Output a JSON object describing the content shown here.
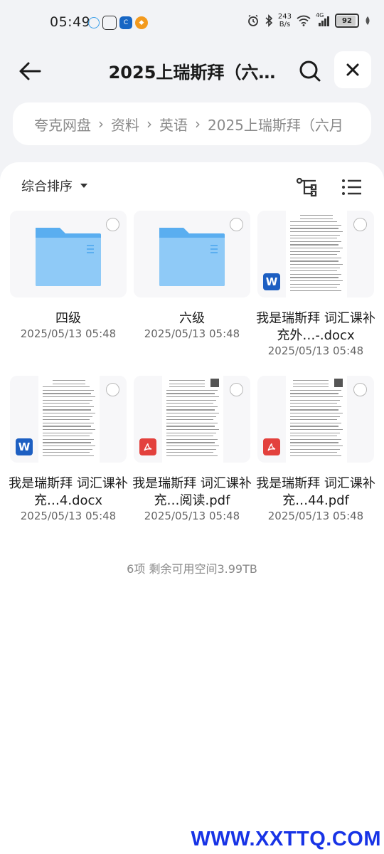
{
  "status_bar": {
    "time": "05:49",
    "net_speed_value": "243",
    "net_speed_unit": "B/s",
    "signal_label": "4G",
    "battery": "92",
    "battery_level": 0.92,
    "app_icons": [
      "cloud-chat-icon",
      "shield-app-icon",
      "bank-app-icon",
      "orange-app-icon"
    ]
  },
  "header": {
    "title": "2025上瑞斯拜（六…"
  },
  "breadcrumb": [
    "夸克网盘",
    "资料",
    "英语",
    "2025上瑞斯拜（六月"
  ],
  "toolbar": {
    "sort_label": "综合排序"
  },
  "files": [
    {
      "kind": "folder",
      "name": "四级",
      "date": "2025/05/13 05:48"
    },
    {
      "kind": "folder",
      "name": "六级",
      "date": "2025/05/13 05:48"
    },
    {
      "kind": "docx",
      "name": "我是瑞斯拜 词汇课补充外…-.docx",
      "date": "2025/05/13 05:48"
    },
    {
      "kind": "docx",
      "name": "我是瑞斯拜 词汇课补充…4.docx",
      "date": "2025/05/13 05:48"
    },
    {
      "kind": "pdf",
      "name": "我是瑞斯拜 词汇课补充…阅读.pdf",
      "date": "2025/05/13 05:48"
    },
    {
      "kind": "pdf",
      "name": "我是瑞斯拜 词汇课补充…44.pdf",
      "date": "2025/05/13 05:48"
    }
  ],
  "summary": "6项 剩余可用空间3.99TB",
  "watermark": "WWW.XXTTQ.COM",
  "colors": {
    "folder": "#7cc0f4",
    "word": "#1d5fc2",
    "pdf": "#e3413d",
    "watermark": "#1733e6"
  }
}
